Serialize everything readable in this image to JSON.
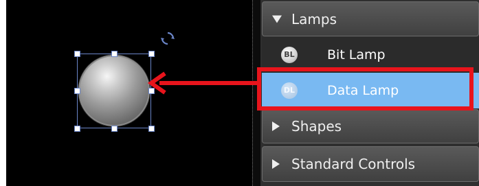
{
  "panel": {
    "groups": [
      {
        "label": "Lamps",
        "expanded": true,
        "items": [
          {
            "badge": "BL",
            "label": "Bit Lamp",
            "selected": false
          },
          {
            "badge": "DL",
            "label": "Data Lamp",
            "selected": true
          }
        ]
      },
      {
        "label": "Shapes",
        "expanded": false
      },
      {
        "label": "Standard Controls",
        "expanded": false
      }
    ]
  },
  "colors": {
    "canvas_bg": "#000000",
    "panel_bg": "#2f2f2f",
    "selected_item_bg": "#79b9f2",
    "selection_handle_border": "#6b86c9",
    "annotation_red": "#e8141c"
  },
  "icons": [
    "rotate-icon",
    "expand-triangle-icon",
    "collapse-triangle-icon",
    "bit-lamp-icon",
    "data-lamp-icon",
    "red-arrow"
  ]
}
